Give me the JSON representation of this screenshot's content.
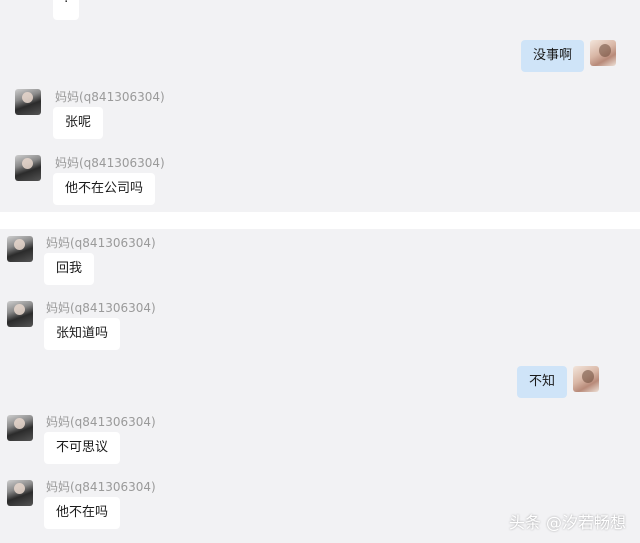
{
  "top_fragment": {
    "text": ":"
  },
  "messages_top": [
    {
      "side": "out",
      "text": "没事啊"
    },
    {
      "side": "in",
      "sender": "妈妈(q841306304)",
      "text": "张呢"
    },
    {
      "side": "in",
      "sender": "妈妈(q841306304)",
      "text": "他不在公司吗"
    }
  ],
  "messages_bottom": [
    {
      "side": "in",
      "sender": "妈妈(q841306304)",
      "text": "回我"
    },
    {
      "side": "in",
      "sender": "妈妈(q841306304)",
      "text": "张知道吗"
    },
    {
      "side": "out",
      "text": "不知"
    },
    {
      "side": "in",
      "sender": "妈妈(q841306304)",
      "text": "不可思议"
    },
    {
      "side": "in",
      "sender": "妈妈(q841306304)",
      "text": "他不在吗"
    }
  ],
  "watermark": "头条 @汐若畅想",
  "colors": {
    "panel": "#f2f2f4",
    "bubble_in": "#ffffff",
    "bubble_out": "#cfe4f8",
    "sender": "#9a9a9a"
  }
}
